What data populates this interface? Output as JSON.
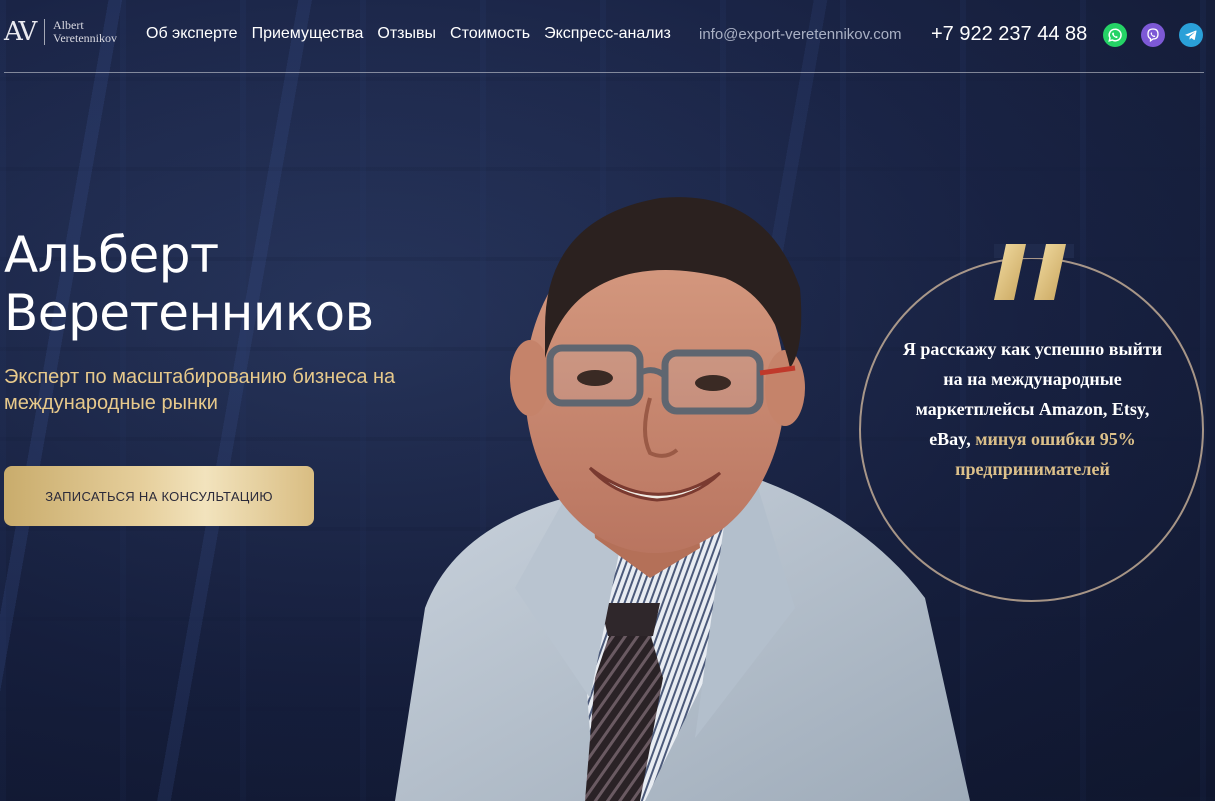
{
  "header": {
    "logo_mark": "AV",
    "logo_line1": "Albert",
    "logo_line2": "Veretennikov",
    "nav": [
      {
        "label": "Об эксперте"
      },
      {
        "label": "Приемущества"
      },
      {
        "label": "Отзывы"
      },
      {
        "label": "Стоимость"
      },
      {
        "label": "Экспресс-анализ"
      }
    ],
    "email": "info@export-veretennikov.com",
    "phone": "+7 922 237 44 88",
    "socials": [
      {
        "icon": "whatsapp-icon",
        "color": "#25d366"
      },
      {
        "icon": "viber-icon",
        "color": "#7d59d6"
      },
      {
        "icon": "telegram-icon",
        "color": "#2aa0d8"
      }
    ]
  },
  "hero": {
    "title_line1": "Альберт",
    "title_line2": "Веретенников",
    "subtitle": "Эксперт по масштабированию бизнеса на международные рынки",
    "cta_label": "ЗАПИСАТЬСЯ НА КОНСУЛЬТАЦИЮ"
  },
  "quote": {
    "text_plain": "Я расскажу как успешно выйти на на международные маркетплейсы Amazon, Etsy, eBay,",
    "text_highlight": "минуя ошибки 95% предпринимателей"
  },
  "colors": {
    "accent_gold": "#e7c98b",
    "background": "#1a2446"
  }
}
